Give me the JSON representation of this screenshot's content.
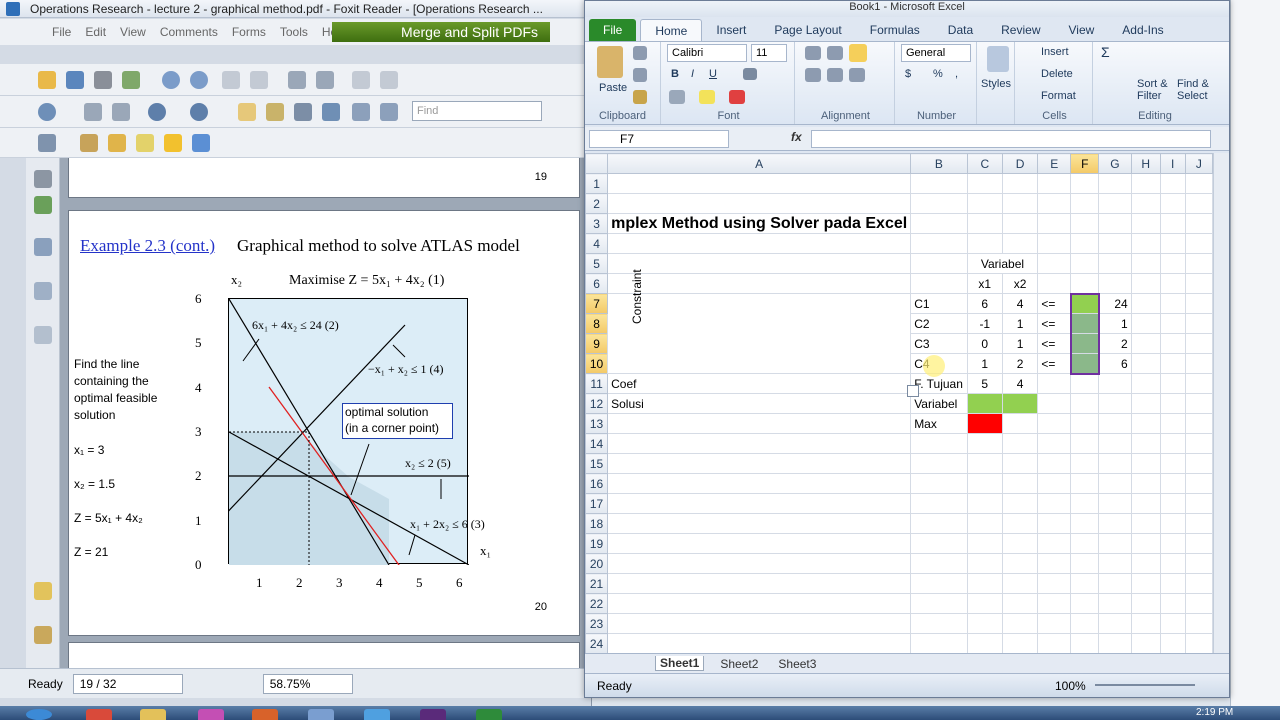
{
  "foxit": {
    "title": "Operations Research - lecture 2 - graphical method.pdf - Foxit Reader - [Operations Research ...",
    "menu": [
      "File",
      "Edit",
      "View",
      "Comments",
      "Forms",
      "Tools",
      "Help"
    ],
    "promo": "Merge and Split PDFs",
    "find_placeholder": "Find",
    "page_top_number": "19",
    "page_bottom_number": "20",
    "example_link": "Example 2.3 (cont.)",
    "example_title": "Graphical method to solve ATLAS model",
    "maximise": "Maximise Z = 5x₁ + 4x₂  (1)",
    "left_text": {
      "find_line": "Find the line containing the optimal feasible solution",
      "x1": "x₁ = 3",
      "x2": "x₂ = 1.5",
      "z_formula": "Z = 5x₁ + 4x₂",
      "z_value": "Z = 21"
    },
    "constraints": {
      "c2": "6x₁ + 4x₂ ≤ 24   (2)",
      "c4": "−x₁ + x₂ ≤ 1   (4)",
      "c5": "x₂ ≤ 2   (5)",
      "c3": "x₁ + 2x₂ ≤ 6   (3)"
    },
    "optimal_box": [
      "optimal solution",
      "(in a corner point)"
    ],
    "axis": {
      "x_label": "x₁",
      "y_label": "x₂",
      "x_ticks": [
        "1",
        "2",
        "3",
        "4",
        "5",
        "6"
      ],
      "y_ticks": [
        "6",
        "5",
        "4",
        "3",
        "2",
        "1",
        "0"
      ]
    },
    "status": {
      "ready": "Ready",
      "page": "19 / 32",
      "zoom": "58.75%"
    }
  },
  "excel": {
    "title": "Book1 - Microsoft Excel",
    "tabs": [
      "File",
      "Home",
      "Insert",
      "Page Layout",
      "Formulas",
      "Data",
      "Review",
      "View",
      "Add-Ins"
    ],
    "ribbon": {
      "paste": "Paste",
      "clipboard": "Clipboard",
      "font_name": "Calibri",
      "font_size": "11",
      "font": "Font",
      "alignment": "Alignment",
      "number_format": "General",
      "number": "Number",
      "styles": "Styles",
      "insert": "Insert",
      "delete": "Delete",
      "format": "Format",
      "cells": "Cells",
      "sort_filter": "Sort & Filter",
      "find_select": "Find & Select",
      "editing": "Editing"
    },
    "name_box": "F7",
    "fx": "fx",
    "columns": [
      "A",
      "B",
      "C",
      "D",
      "E",
      "F",
      "G",
      "H",
      "I",
      "J"
    ],
    "rows": [
      "1",
      "2",
      "3",
      "4",
      "5",
      "6",
      "7",
      "8",
      "9",
      "10",
      "11",
      "12",
      "13",
      "14",
      "15",
      "16",
      "17",
      "18",
      "19",
      "20",
      "21",
      "22",
      "23",
      "24"
    ],
    "cells": {
      "title": "mplex Method using Solver pada Excel",
      "variabel_hdr": "Variabel",
      "x1": "x1",
      "x2": "x2",
      "constraint": "Constraint",
      "c1": "C1",
      "c2": "C2",
      "c3": "C3",
      "c4": "C4",
      "c1_x1": "6",
      "c1_x2": "4",
      "c2_x1": "-1",
      "c2_x2": "1",
      "c3_x1": "0",
      "c3_x2": "1",
      "c4_x1": "1",
      "c4_x2": "2",
      "le": "<=",
      "rhs1": "24",
      "rhs2": "1",
      "rhs3": "2",
      "rhs4": "6",
      "coef": "Coef",
      "f_tujuan": "F. Tujuan",
      "coef_x1": "5",
      "coef_x2": "4",
      "solusi": "Solusi",
      "variabel": "Variabel",
      "max": "Max"
    },
    "sheets": [
      "Sheet1",
      "Sheet2",
      "Sheet3"
    ],
    "status": {
      "ready": "Ready",
      "zoom": "100%"
    }
  },
  "taskbar": {
    "time": "2:19 PM"
  },
  "colors": {
    "green_cell": "#92d050",
    "red_cell": "#ff0000",
    "selection": "#7030a0"
  }
}
